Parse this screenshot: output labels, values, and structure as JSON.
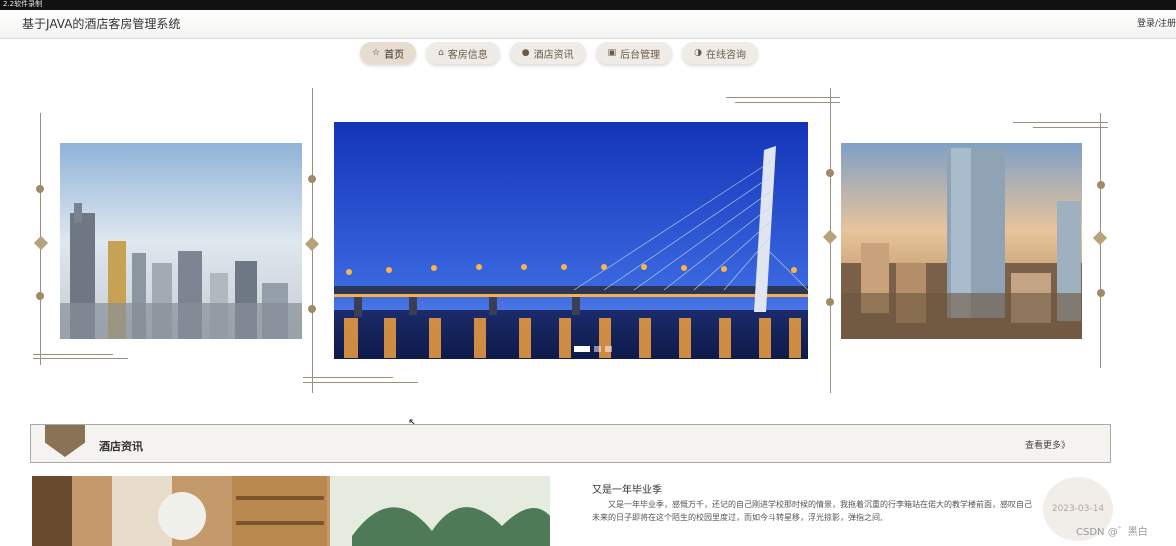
{
  "recording_label": "2.2软件录制",
  "header": {
    "title": "基于JAVA的酒店客房管理系统",
    "auth": "登录/注册"
  },
  "nav": [
    {
      "icon": "star-icon",
      "glyph": "☆",
      "label": "首页"
    },
    {
      "icon": "bag-icon",
      "glyph": "⌂",
      "label": "客房信息"
    },
    {
      "icon": "info-icon",
      "glyph": "●",
      "label": "酒店资讯"
    },
    {
      "icon": "folder-icon",
      "glyph": "▣",
      "label": "后台管理"
    },
    {
      "icon": "headset-icon",
      "glyph": "◑",
      "label": "在线咨询"
    }
  ],
  "news": {
    "title": "酒店资讯",
    "more": "查看更多》"
  },
  "article": {
    "title": "又是一年毕业季",
    "body": "又是一年毕业季，感慨万千，还记的自己刚进学校那时候的情景，我拖着沉重的行李箱站在偌大的教学楼前面，感叹自己未来的日子即将在这个陌生的校园里度过，而如今斗转星移，浮光掠影，弹指之间,",
    "date": "2023-03-14"
  },
  "watermark": "CSDN @゛黑白",
  "colors": {
    "accent": "#8a7256",
    "nav_bg": "#efece7"
  }
}
